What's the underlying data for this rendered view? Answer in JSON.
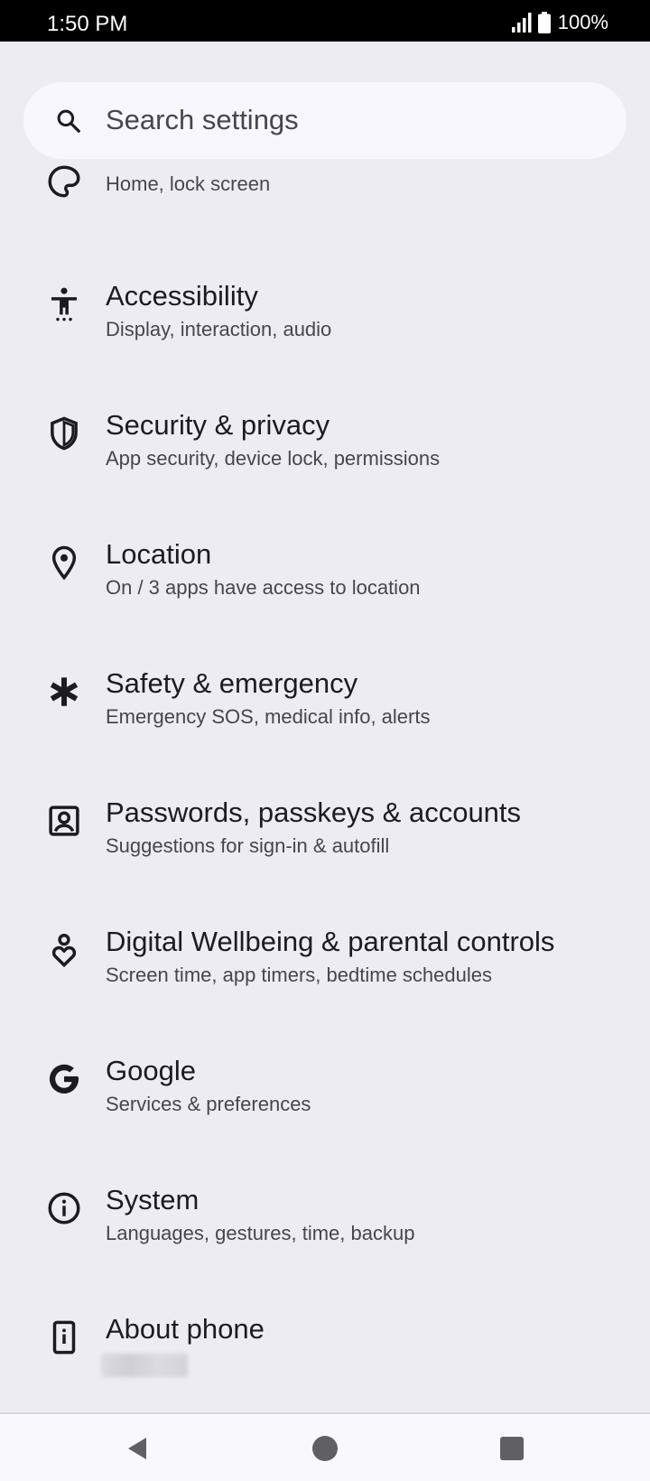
{
  "status_bar": {
    "time": "1:50 PM",
    "battery_percent": "100%",
    "icons": [
      "signal-icon",
      "battery-icon"
    ]
  },
  "search": {
    "placeholder": "Search settings",
    "icon": "search-icon"
  },
  "items": [
    {
      "title": "",
      "subtitle": "Home, lock screen",
      "icon": "wallpaper-style-icon"
    },
    {
      "title": "Accessibility",
      "subtitle": "Display, interaction, audio",
      "icon": "accessibility-icon"
    },
    {
      "title": "Security & privacy",
      "subtitle": "App security, device lock, permissions",
      "icon": "shield-icon"
    },
    {
      "title": "Location",
      "subtitle": "On / 3 apps have access to location",
      "icon": "location-pin-icon"
    },
    {
      "title": "Safety & emergency",
      "subtitle": "Emergency SOS, medical info, alerts",
      "icon": "asterisk-icon"
    },
    {
      "title": "Passwords, passkeys & accounts",
      "subtitle": "Suggestions for sign-in & autofill",
      "icon": "account-box-icon"
    },
    {
      "title": "Digital Wellbeing & parental controls",
      "subtitle": "Screen time, app timers, bedtime schedules",
      "icon": "wellbeing-heart-icon"
    },
    {
      "title": "Google",
      "subtitle": "Services & preferences",
      "icon": "google-g-icon"
    },
    {
      "title": "System",
      "subtitle": "Languages, gestures, time, backup",
      "icon": "info-icon"
    },
    {
      "title": "About phone",
      "subtitle": "",
      "icon": "phone-info-icon"
    }
  ],
  "nav_bar": {
    "buttons": [
      "back-icon",
      "home-icon",
      "recents-icon"
    ]
  },
  "colors": {
    "background": "#eeecf3",
    "search_background": "#f8f7fd",
    "title_text": "#1b1b21",
    "subtitle_text": "#45464f",
    "status_bar": "#000000"
  }
}
